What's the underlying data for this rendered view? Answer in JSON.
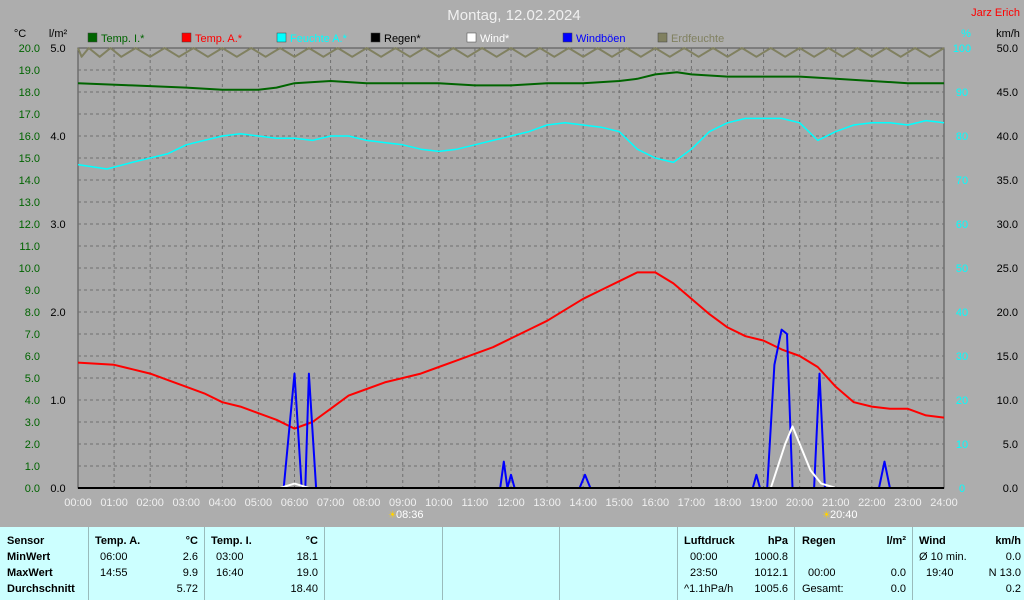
{
  "title": "Montag, 12.02.2024",
  "author": "Jarz Erich",
  "units": {
    "temp": "°C",
    "rain": "l/m²",
    "humidity": "%",
    "wind": "km/h"
  },
  "legend": [
    {
      "label": "Temp. I.*",
      "color": "#006400"
    },
    {
      "label": "Temp. A.*",
      "color": "#ff0000"
    },
    {
      "label": "Feuchte A.*",
      "color": "#00ffff"
    },
    {
      "label": "Regen*",
      "color": "#000000"
    },
    {
      "label": "Wind*",
      "color": "#ffffff"
    },
    {
      "label": "Windböen",
      "color": "#0000ff"
    },
    {
      "label": "Erdfeuchte",
      "color": "#808060"
    }
  ],
  "time_markers": [
    {
      "label": "08:36",
      "icon": "sunrise-icon"
    },
    {
      "label": "20:40",
      "icon": "sunset-icon"
    }
  ],
  "chart_data": {
    "type": "line",
    "xlabel": "",
    "x_ticks": [
      "00:00",
      "01:00",
      "02:00",
      "03:00",
      "04:00",
      "05:00",
      "06:00",
      "07:00",
      "08:00",
      "09:00",
      "10:00",
      "11:00",
      "12:00",
      "13:00",
      "14:00",
      "15:00",
      "16:00",
      "17:00",
      "18:00",
      "19:00",
      "20:00",
      "21:00",
      "22:00",
      "23:00",
      "24:00"
    ],
    "xlim": [
      0,
      24
    ],
    "axes": {
      "temp": {
        "label": "°C",
        "ylim": [
          0,
          20
        ],
        "ticks": [
          "0.0",
          "1.0",
          "2.0",
          "3.0",
          "4.0",
          "5.0",
          "6.0",
          "7.0",
          "8.0",
          "9.0",
          "10.0",
          "11.0",
          "12.0",
          "13.0",
          "14.0",
          "15.0",
          "16.0",
          "17.0",
          "18.0",
          "19.0",
          "20.0"
        ]
      },
      "rain": {
        "label": "l/m²",
        "ylim": [
          0,
          5
        ],
        "ticks": [
          "0.0",
          "1.0",
          "2.0",
          "3.0",
          "4.0",
          "5.0"
        ]
      },
      "humidity": {
        "label": "%",
        "ylim": [
          0,
          100
        ],
        "ticks": [
          "0",
          "10",
          "20",
          "30",
          "40",
          "50",
          "60",
          "70",
          "80",
          "90",
          "100"
        ]
      },
      "wind": {
        "label": "km/h",
        "ylim": [
          0,
          50
        ],
        "ticks": [
          "0.0",
          "5.0",
          "10.0",
          "15.0",
          "20.0",
          "25.0",
          "30.0",
          "35.0",
          "40.0",
          "45.0",
          "50.0"
        ]
      }
    },
    "grid": true,
    "legend_position": "top",
    "series": [
      {
        "name": "Erdfeuchte",
        "axis": "humidity",
        "color": "#808060",
        "points": [
          [
            0,
            100
          ],
          [
            0.1,
            98
          ],
          [
            0.3,
            100
          ],
          [
            0.6,
            98
          ],
          [
            0.9,
            100
          ],
          [
            1.2,
            98
          ],
          [
            1.6,
            100
          ],
          [
            2,
            98
          ],
          [
            2.4,
            100
          ],
          [
            2.8,
            98
          ],
          [
            3.2,
            100
          ],
          [
            3.6,
            98
          ],
          [
            4,
            100
          ],
          [
            4.4,
            98
          ],
          [
            4.8,
            100
          ],
          [
            5.2,
            98
          ],
          [
            5.6,
            100
          ],
          [
            6,
            98
          ],
          [
            6.4,
            100
          ],
          [
            6.8,
            98
          ],
          [
            7.2,
            100
          ],
          [
            7.6,
            98
          ],
          [
            8,
            100
          ],
          [
            8.4,
            98
          ],
          [
            8.8,
            100
          ],
          [
            9.2,
            98
          ],
          [
            9.6,
            100
          ],
          [
            10,
            98
          ],
          [
            10.4,
            100
          ],
          [
            10.8,
            98
          ],
          [
            11.2,
            100
          ],
          [
            11.6,
            98
          ],
          [
            12,
            100
          ],
          [
            12.4,
            98
          ],
          [
            12.8,
            100
          ],
          [
            13.2,
            98
          ],
          [
            13.6,
            100
          ],
          [
            14,
            98
          ],
          [
            14.4,
            100
          ],
          [
            14.8,
            98
          ],
          [
            15.2,
            100
          ],
          [
            15.6,
            98
          ],
          [
            16,
            100
          ],
          [
            16.4,
            98
          ],
          [
            16.8,
            100
          ],
          [
            17.2,
            98
          ],
          [
            17.6,
            100
          ],
          [
            18,
            98
          ],
          [
            18.4,
            100
          ],
          [
            18.8,
            98
          ],
          [
            19.2,
            100
          ],
          [
            19.6,
            98
          ],
          [
            20,
            100
          ],
          [
            20.4,
            98
          ],
          [
            20.8,
            100
          ],
          [
            21.2,
            98
          ],
          [
            21.6,
            100
          ],
          [
            22,
            98
          ],
          [
            22.4,
            100
          ],
          [
            22.8,
            98
          ],
          [
            23.2,
            100
          ],
          [
            23.6,
            98
          ],
          [
            24,
            100
          ]
        ]
      },
      {
        "name": "Temp. I.*",
        "axis": "temp",
        "color": "#006400",
        "points": [
          [
            0,
            18.4
          ],
          [
            1.5,
            18.3
          ],
          [
            3,
            18.2
          ],
          [
            4,
            18.1
          ],
          [
            5,
            18.1
          ],
          [
            5.5,
            18.2
          ],
          [
            6,
            18.4
          ],
          [
            7,
            18.5
          ],
          [
            8,
            18.4
          ],
          [
            9,
            18.4
          ],
          [
            10,
            18.4
          ],
          [
            11,
            18.3
          ],
          [
            12,
            18.3
          ],
          [
            13,
            18.4
          ],
          [
            14,
            18.4
          ],
          [
            15,
            18.5
          ],
          [
            15.5,
            18.6
          ],
          [
            16,
            18.8
          ],
          [
            16.6,
            18.9
          ],
          [
            17,
            18.8
          ],
          [
            18,
            18.7
          ],
          [
            19,
            18.7
          ],
          [
            20,
            18.7
          ],
          [
            21,
            18.6
          ],
          [
            22,
            18.5
          ],
          [
            23,
            18.4
          ],
          [
            24,
            18.4
          ]
        ]
      },
      {
        "name": "Feuchte A.*",
        "axis": "humidity",
        "color": "#00ffff",
        "points": [
          [
            0,
            73.5
          ],
          [
            0.8,
            72.5
          ],
          [
            1.5,
            74
          ],
          [
            2,
            75
          ],
          [
            2.5,
            76
          ],
          [
            3,
            78
          ],
          [
            3.5,
            79
          ],
          [
            4,
            80
          ],
          [
            4.5,
            80.5
          ],
          [
            5,
            80
          ],
          [
            5.5,
            79.5
          ],
          [
            6,
            79.5
          ],
          [
            6.5,
            79
          ],
          [
            7,
            80
          ],
          [
            7.5,
            80
          ],
          [
            8,
            79
          ],
          [
            8.5,
            78.5
          ],
          [
            9,
            78
          ],
          [
            9.5,
            77
          ],
          [
            10,
            76.5
          ],
          [
            10.5,
            77
          ],
          [
            11,
            78
          ],
          [
            11.5,
            79
          ],
          [
            12,
            80
          ],
          [
            12.5,
            81
          ],
          [
            13,
            82.5
          ],
          [
            13.5,
            83
          ],
          [
            14,
            82.5
          ],
          [
            14.5,
            82
          ],
          [
            15,
            81
          ],
          [
            15.5,
            77
          ],
          [
            16,
            75
          ],
          [
            16.5,
            74
          ],
          [
            17,
            77
          ],
          [
            17.5,
            81
          ],
          [
            18,
            83
          ],
          [
            18.5,
            84
          ],
          [
            19,
            84
          ],
          [
            19.5,
            84
          ],
          [
            20,
            83
          ],
          [
            20.5,
            79
          ],
          [
            21,
            81
          ],
          [
            21.5,
            82.5
          ],
          [
            22,
            83
          ],
          [
            22.5,
            83
          ],
          [
            23,
            82.5
          ],
          [
            23.5,
            83.5
          ],
          [
            24,
            83
          ]
        ]
      },
      {
        "name": "Temp. A.*",
        "axis": "temp",
        "color": "#ff0000",
        "points": [
          [
            0,
            5.7
          ],
          [
            1,
            5.6
          ],
          [
            1.5,
            5.4
          ],
          [
            2,
            5.2
          ],
          [
            2.5,
            4.9
          ],
          [
            3,
            4.6
          ],
          [
            3.5,
            4.3
          ],
          [
            4,
            3.9
          ],
          [
            4.5,
            3.7
          ],
          [
            5,
            3.4
          ],
          [
            5.5,
            3.1
          ],
          [
            6,
            2.7
          ],
          [
            6.5,
            3.0
          ],
          [
            7,
            3.6
          ],
          [
            7.5,
            4.2
          ],
          [
            8,
            4.5
          ],
          [
            8.5,
            4.8
          ],
          [
            9,
            5.0
          ],
          [
            9.5,
            5.2
          ],
          [
            10,
            5.5
          ],
          [
            10.5,
            5.8
          ],
          [
            11,
            6.1
          ],
          [
            11.5,
            6.4
          ],
          [
            12,
            6.8
          ],
          [
            12.5,
            7.2
          ],
          [
            13,
            7.6
          ],
          [
            13.5,
            8.1
          ],
          [
            14,
            8.6
          ],
          [
            14.5,
            9.0
          ],
          [
            15,
            9.4
          ],
          [
            15.5,
            9.8
          ],
          [
            16,
            9.8
          ],
          [
            16.5,
            9.3
          ],
          [
            17,
            8.6
          ],
          [
            17.5,
            7.9
          ],
          [
            18,
            7.3
          ],
          [
            18.5,
            6.9
          ],
          [
            19,
            6.7
          ],
          [
            19.5,
            6.3
          ],
          [
            20,
            6.0
          ],
          [
            20.5,
            5.5
          ],
          [
            21,
            4.6
          ],
          [
            21.5,
            3.9
          ],
          [
            22,
            3.7
          ],
          [
            22.5,
            3.6
          ],
          [
            23,
            3.6
          ],
          [
            23.5,
            3.3
          ],
          [
            24,
            3.2
          ]
        ]
      },
      {
        "name": "Windböen",
        "axis": "wind",
        "color": "#0000ff",
        "points": [
          [
            0,
            0
          ],
          [
            5.7,
            0
          ],
          [
            6,
            13
          ],
          [
            6.2,
            0
          ],
          [
            6.3,
            0
          ],
          [
            6.4,
            13
          ],
          [
            6.6,
            0
          ],
          [
            11.7,
            0
          ],
          [
            11.8,
            3
          ],
          [
            11.9,
            0
          ],
          [
            12,
            1.5
          ],
          [
            12.1,
            0
          ],
          [
            13.9,
            0
          ],
          [
            14.05,
            1.5
          ],
          [
            14.2,
            0
          ],
          [
            18.7,
            0
          ],
          [
            18.8,
            1.5
          ],
          [
            18.9,
            0
          ],
          [
            19.1,
            0
          ],
          [
            19.3,
            14
          ],
          [
            19.5,
            18
          ],
          [
            19.65,
            17.5
          ],
          [
            19.8,
            0
          ],
          [
            20.4,
            0
          ],
          [
            20.55,
            13
          ],
          [
            20.7,
            0
          ],
          [
            22.2,
            0
          ],
          [
            22.35,
            3
          ],
          [
            22.5,
            0
          ],
          [
            24,
            0
          ]
        ]
      },
      {
        "name": "Wind*",
        "axis": "wind",
        "color": "#ffffff",
        "points": [
          [
            0,
            0
          ],
          [
            5.6,
            0
          ],
          [
            6,
            0.5
          ],
          [
            6.4,
            0
          ],
          [
            19.2,
            0
          ],
          [
            19.6,
            5
          ],
          [
            19.8,
            7
          ],
          [
            20,
            5
          ],
          [
            20.3,
            2
          ],
          [
            20.6,
            0.5
          ],
          [
            21,
            0
          ],
          [
            24,
            0
          ]
        ]
      },
      {
        "name": "Regen*",
        "axis": "rain",
        "color": "#000000",
        "points": [
          [
            0,
            0
          ],
          [
            24,
            0
          ]
        ]
      }
    ]
  },
  "footer": {
    "sensor": {
      "header": "Sensor",
      "rows": [
        "MinWert",
        "MaxWert",
        "Durchschnitt"
      ]
    },
    "temp_a": {
      "header": "Temp. A.",
      "unit": "°C",
      "min_time": "06:00",
      "min_val": "2.6",
      "max_time": "14:55",
      "max_val": "9.9",
      "avg": "5.72"
    },
    "temp_i": {
      "header": "Temp. I.",
      "unit": "°C",
      "min_time": "03:00",
      "min_val": "18.1",
      "max_time": "16:40",
      "max_val": "19.0",
      "avg": "18.40"
    },
    "pressure": {
      "header": "Luftdruck",
      "unit": "hPa",
      "min_time": "00:00",
      "min_val": "1000.8",
      "max_time": "23:50",
      "max_val": "1012.1",
      "trend": "^1.1hPa/h",
      "avg": "1005.6"
    },
    "rain": {
      "header": "Regen",
      "unit": "l/m²",
      "max_time": "00:00",
      "max_val": "0.0",
      "total_label": "Gesamt:",
      "total": "0.0"
    },
    "wind": {
      "header": "Wind",
      "unit": "km/h",
      "avg_label": "Ø 10 min.",
      "avg_val": "0.0",
      "max_time": "19:40",
      "max_val": "N 13.0",
      "gust_val": "0.2"
    }
  }
}
